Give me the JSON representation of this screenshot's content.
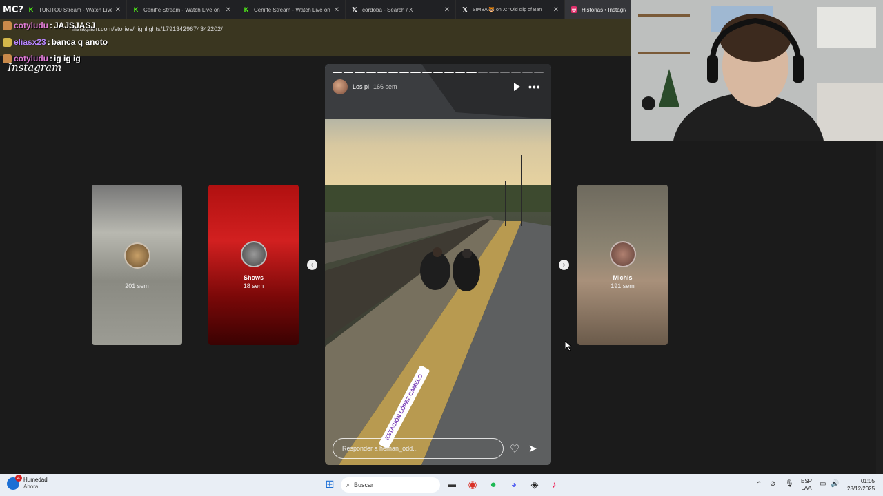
{
  "corner_label": "MC?",
  "tabs": [
    {
      "label": "TUKITO0 Stream - Watch Live o",
      "icon": "kick-icon",
      "color": "#53fc18"
    },
    {
      "label": "Ceniffe Stream - Watch Live on",
      "icon": "kick-icon",
      "color": "#53fc18"
    },
    {
      "label": "Ceniffe Stream - Watch Live on",
      "icon": "kick-icon",
      "color": "#53fc18"
    },
    {
      "label": "cordoba - Search / X",
      "icon": "x-icon",
      "color": "#ffffff"
    },
    {
      "label": "SIMBA 🐯 on X: \"Old clip of Ban",
      "icon": "x-icon",
      "color": "#ffffff"
    },
    {
      "label": "Historias • Instagram",
      "icon": "instagram-icon",
      "color": "#e1306c"
    }
  ],
  "url": "instagram.com/stories/highlights/17913429674342202/",
  "chat": [
    {
      "user": "cotyludu",
      "message": "JAJSJASJ"
    },
    {
      "user": "eliasx23",
      "message": "banca q anoto"
    },
    {
      "user": "cotyludu",
      "message": "ig ig ig"
    }
  ],
  "chat_sep": ":",
  "instagram_logo": "Instagram",
  "side_stories": [
    {
      "name": "",
      "age": "201 sem"
    },
    {
      "name": "Shows",
      "age": "18 sem"
    },
    {
      "name": "Michis",
      "age": "191 sem"
    }
  ],
  "main_story": {
    "user": "Los pi",
    "time": "166 sem",
    "progress_total": 19,
    "progress_done": 13,
    "location_sticker": "ESTACIÓN LÓPEZ CAMELO",
    "reply_placeholder": "Responder a hernan_odd..."
  },
  "taskbar": {
    "weather_label": "Humedad",
    "weather_sub": "Ahora",
    "weather_badge": "4",
    "search_placeholder": "Buscar",
    "lang_top": "ESP",
    "lang_bottom": "LAA",
    "time": "01:05",
    "date": "28/12/2025"
  }
}
